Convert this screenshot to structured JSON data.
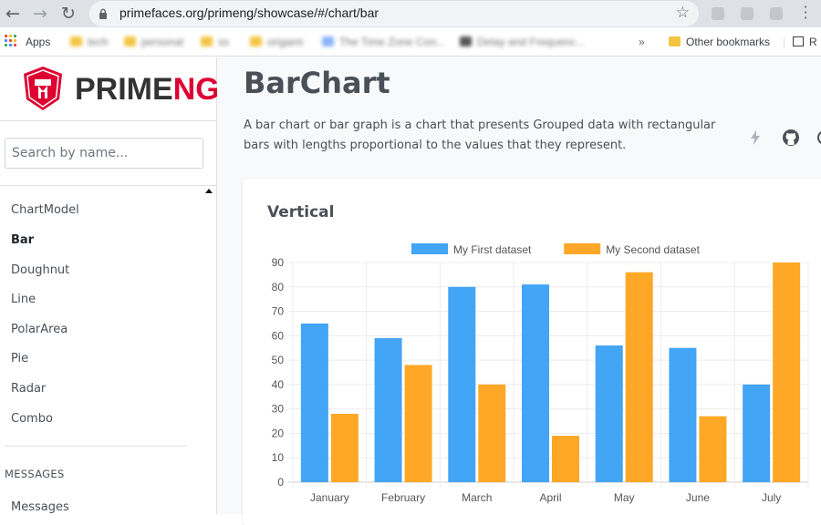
{
  "browser": {
    "url": "primefaces.org/primeng/showcase/#/chart/bar",
    "bookmarks": [
      {
        "label": "Apps"
      },
      {
        "label": "tech"
      },
      {
        "label": "personal"
      },
      {
        "label": "ss"
      },
      {
        "label": "origami"
      },
      {
        "label": "The Time Zone Con..."
      },
      {
        "label": "Delay and Frequenc..."
      },
      {
        "label": "Other bookmarks"
      },
      {
        "label": "R"
      }
    ]
  },
  "sidebar": {
    "logo_prime": "PRIME",
    "logo_ng": "NG",
    "search_placeholder": "Search by name...",
    "items": [
      {
        "label": "ChartModel"
      },
      {
        "label": "Bar"
      },
      {
        "label": "Doughnut"
      },
      {
        "label": "Line"
      },
      {
        "label": "PolarArea"
      },
      {
        "label": "Pie"
      },
      {
        "label": "Radar"
      },
      {
        "label": "Combo"
      }
    ],
    "section_title": "MESSAGES",
    "section_items": [
      {
        "label": "Messages"
      }
    ]
  },
  "main": {
    "title": "BarChart",
    "description": "A bar chart or bar graph is a chart that presents Grouped data with rectangular bars with lengths proportional to the values that they represent.",
    "icons": [
      "bolt-icon",
      "github-icon"
    ]
  },
  "card": {
    "title": "Vertical"
  },
  "colors": {
    "series1": "#42A5F5",
    "series2": "#FFA726",
    "brand_red": "#dd0031"
  },
  "chart_data": {
    "type": "bar",
    "title": "",
    "categories": [
      "January",
      "February",
      "March",
      "April",
      "May",
      "June",
      "July"
    ],
    "series": [
      {
        "name": "My First dataset",
        "values": [
          65,
          59,
          80,
          81,
          56,
          55,
          40
        ]
      },
      {
        "name": "My Second dataset",
        "values": [
          28,
          48,
          40,
          19,
          86,
          27,
          90
        ]
      }
    ],
    "ylim": [
      0,
      90
    ],
    "yticks": [
      0,
      10,
      20,
      30,
      40,
      50,
      60,
      70,
      80,
      90
    ],
    "grid": true,
    "legend": "top"
  }
}
